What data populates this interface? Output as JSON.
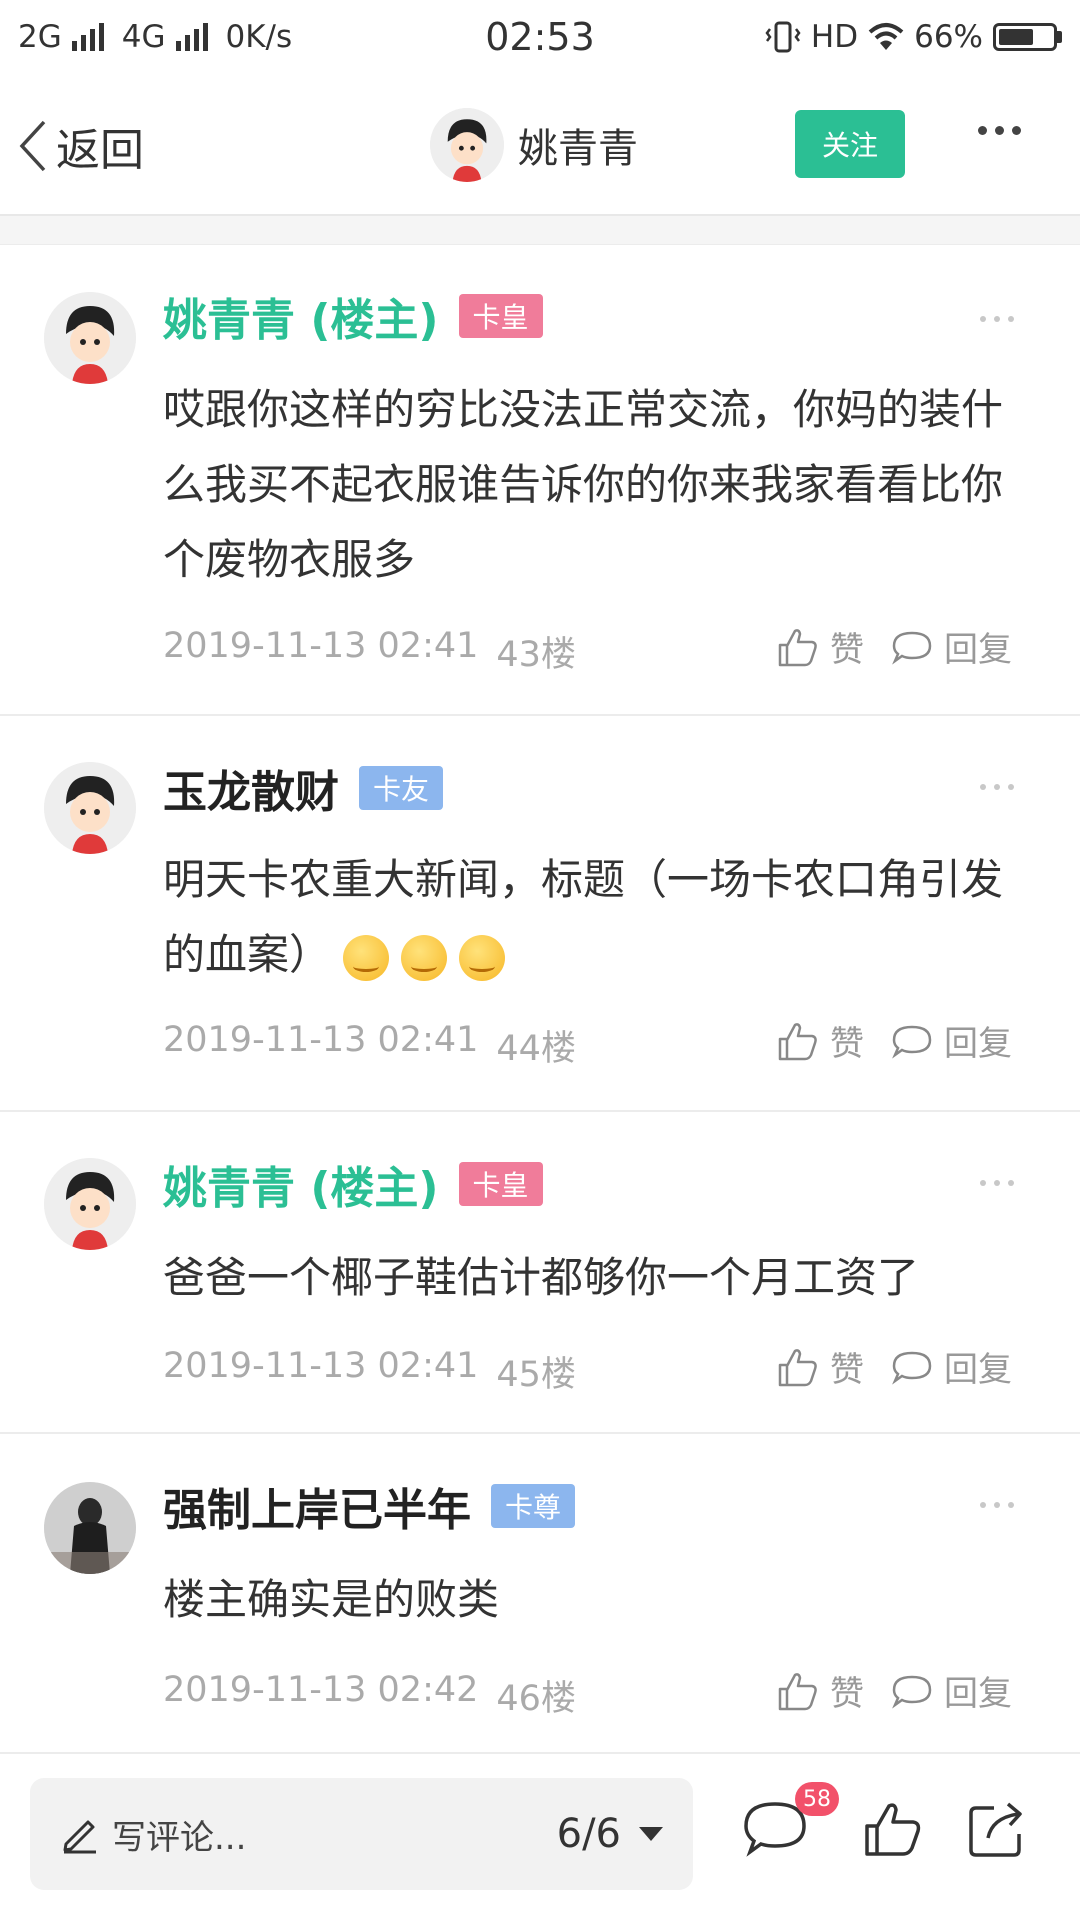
{
  "status_bar": {
    "network_left": "2G",
    "network_right": "4G",
    "speed": "0K/s",
    "time": "02:53",
    "hd": "HD",
    "battery": "66%",
    "battery_level": 0.66
  },
  "header": {
    "back_label": "返回",
    "user_name": "姚青青",
    "follow_label": "关注"
  },
  "comments": [
    {
      "name": "姚青青 (楼主)",
      "badge": "卡皇",
      "text": "哎跟你这样的穷比没法正常交流，你妈的装什么我买不起衣服谁告诉你的你来我家看看比你个废物衣服多",
      "date": "2019-11-13 02:41",
      "floor": "43楼",
      "like": "赞",
      "reply": "回复"
    },
    {
      "name": "玉龙散财",
      "badge": "卡友",
      "text": "明天卡农重大新闻，标题（一场卡农口角引发的血案）",
      "date": "2019-11-13 02:41",
      "floor": "44楼",
      "like": "赞",
      "reply": "回复"
    },
    {
      "name": "姚青青 (楼主)",
      "badge": "卡皇",
      "text": "爸爸一个椰子鞋估计都够你一个月工资了",
      "date": "2019-11-13 02:41",
      "floor": "45楼",
      "like": "赞",
      "reply": "回复"
    },
    {
      "name": "强制上岸已半年",
      "badge": "卡尊",
      "text": "楼主确实是的败类",
      "date": "2019-11-13 02:42",
      "floor": "46楼",
      "like": "赞",
      "reply": "回复"
    }
  ],
  "bottom_bar": {
    "placeholder": "写评论...",
    "page": "6/6",
    "comment_count": "58"
  },
  "colors": {
    "accent": "#2bbf94",
    "badge_pink": "#f07c9a",
    "badge_blue": "#8cb6ee",
    "notif_red": "#f2516a"
  },
  "icons": [
    "back-chevron-icon",
    "more-dots-icon",
    "thumbs-up-icon",
    "speech-bubble-icon",
    "pencil-icon",
    "share-icon",
    "smirk-emoji-icon"
  ]
}
